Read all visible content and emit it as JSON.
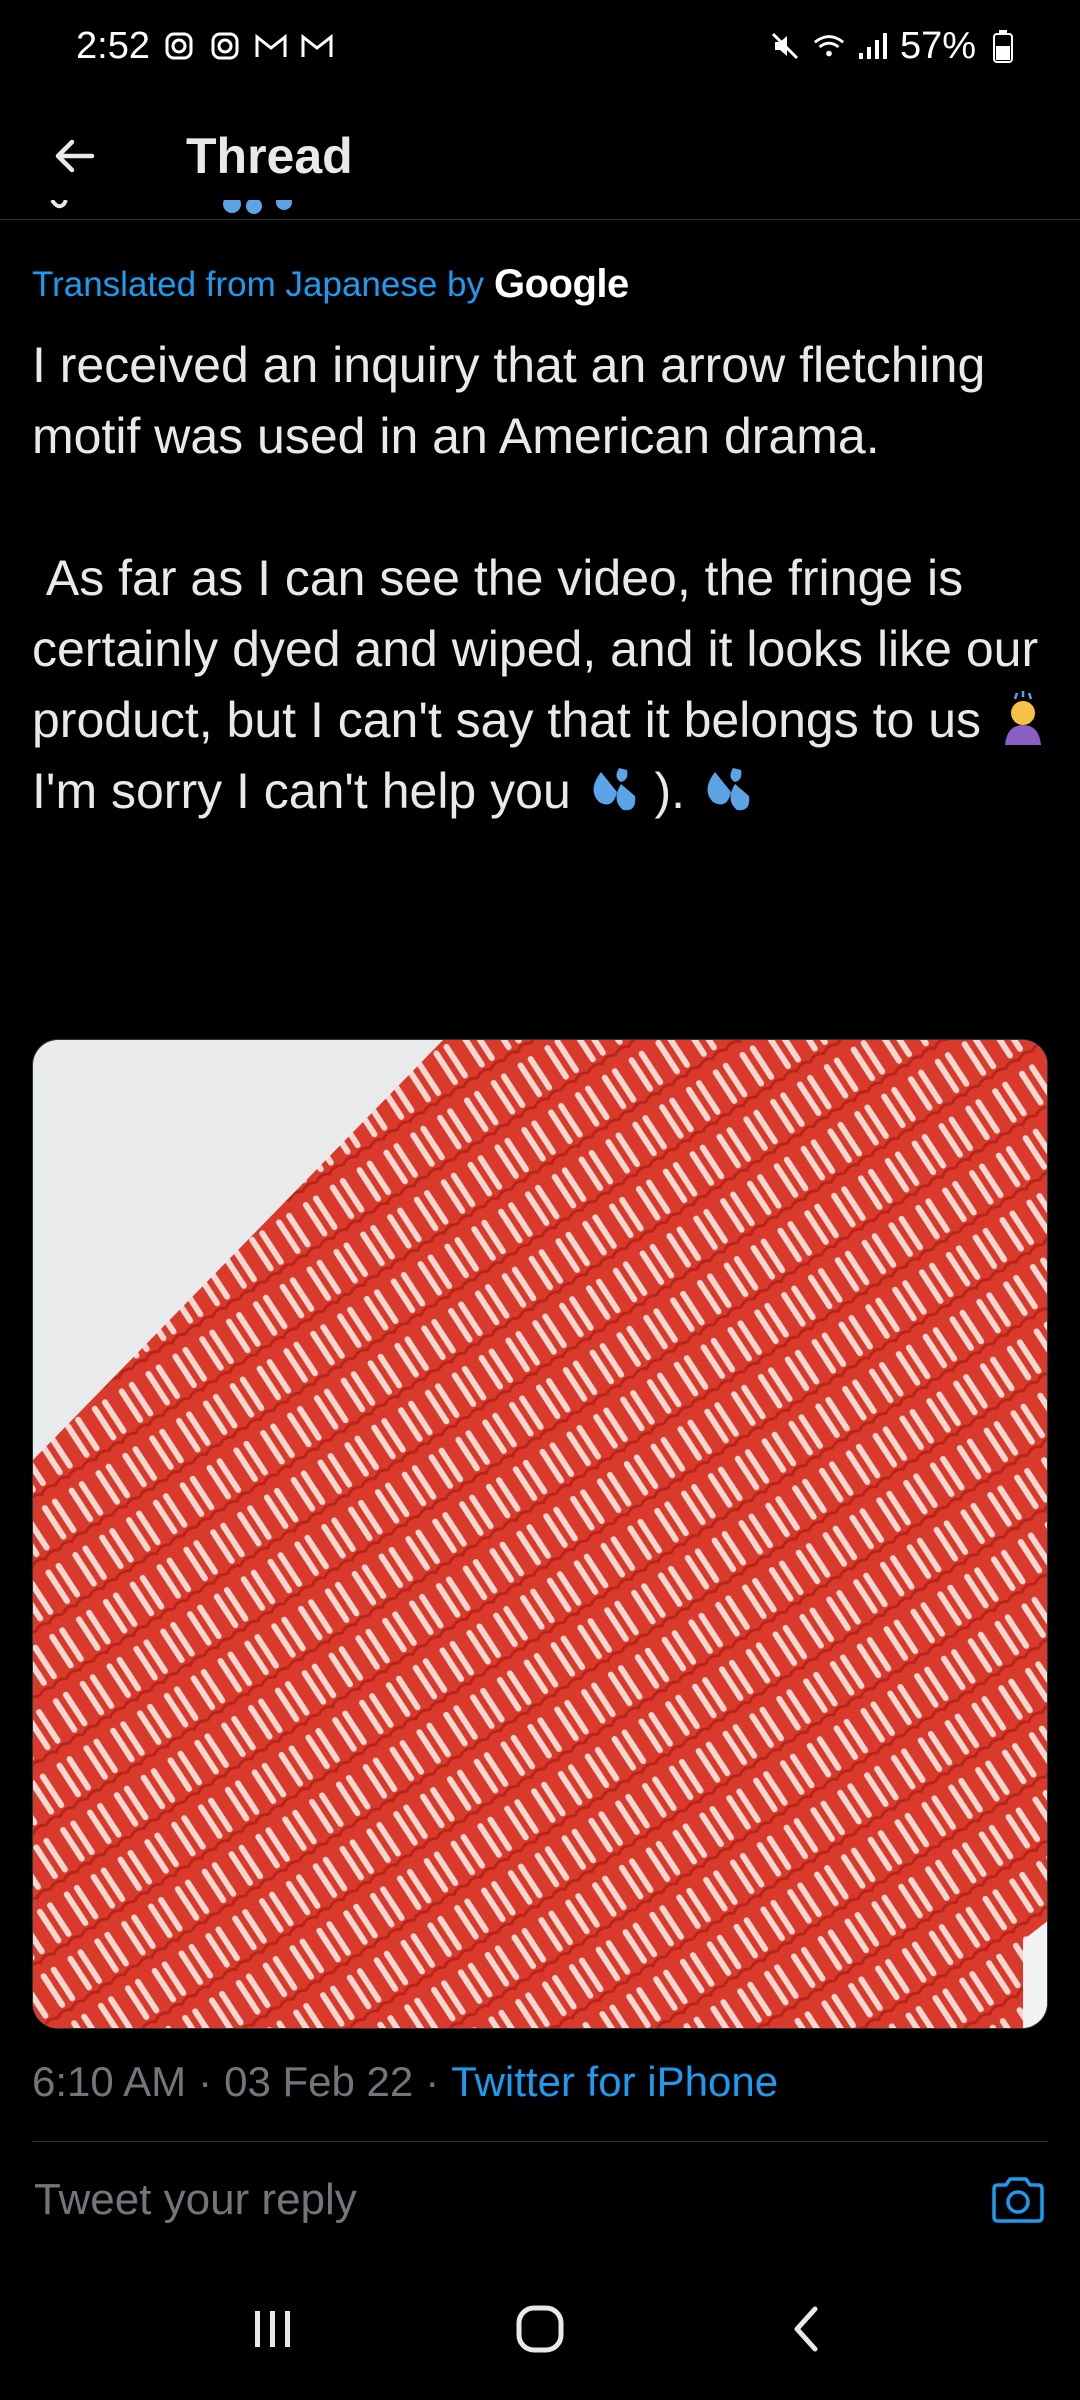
{
  "status_bar": {
    "time": "2:52",
    "battery": "57%",
    "left_icons": [
      "instagram-icon",
      "instagram-icon",
      "gmail-icon",
      "gmail-icon"
    ],
    "right_icons": [
      "mute-icon",
      "wifi-icon",
      "signal-icon",
      "battery-icon"
    ]
  },
  "header": {
    "title": "Thread"
  },
  "tweet": {
    "translated_label": "Translated from Japanese by",
    "translator": "Google",
    "text_p1": "I received an inquiry that an arrow fletching motif was used in an American drama.",
    "text_p2_a": " As far as I can see the video, the fringe is certainly dyed and wiped, and it looks like our product, but I can't say that it belongs to us ",
    "text_p2_b": " I'm sorry I can't help you ",
    "text_p2_c": " ). ",
    "time": "6:10 AM",
    "date": "03 Feb 22",
    "source": "Twitter for iPhone",
    "separator": "·"
  },
  "reply": {
    "placeholder": "Tweet your reply"
  },
  "colors": {
    "background": "#000000",
    "accent": "#1d9bf0",
    "text": "#e7e9ea",
    "muted": "#71767b",
    "fabric_red": "#d93a2b"
  }
}
